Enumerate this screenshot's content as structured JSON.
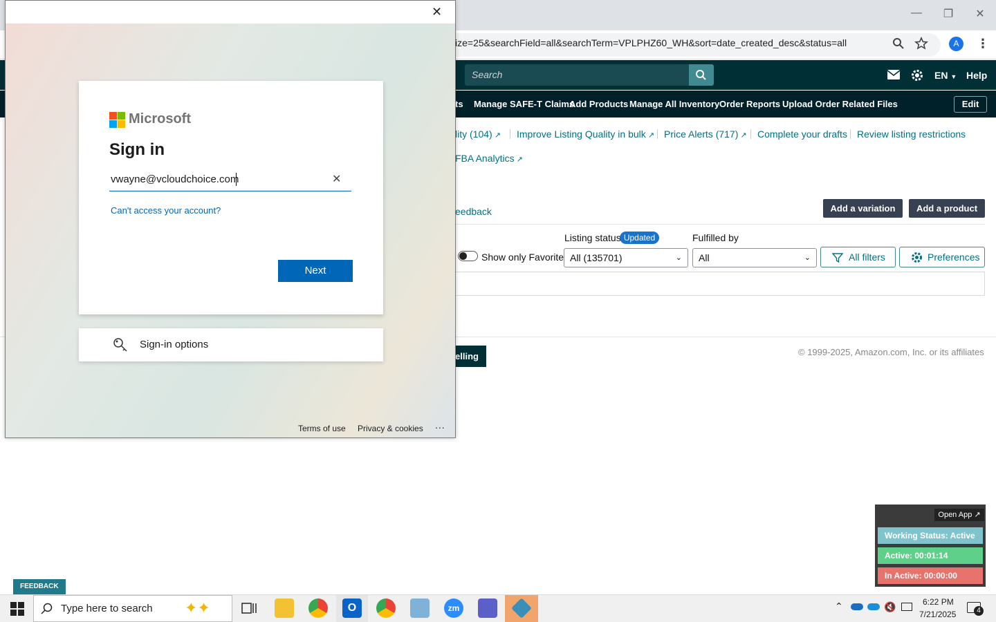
{
  "browser": {
    "url": "ize=25&searchField=all&searchTerm=VPLPHZ60_WH&sort=date_created_desc&status=all",
    "profile_initial": "A"
  },
  "amazon": {
    "search_placeholder": "Search",
    "language": "EN",
    "help": "Help",
    "subnav": [
      "ts",
      "Manage SAFE-T Claims",
      "Add Products",
      "Manage All Inventory",
      "Order Reports",
      "Upload Order Related Files"
    ],
    "edit": "Edit",
    "links_row1": [
      "lity (104)",
      "Improve Listing Quality in bulk",
      "Price Alerts (717)",
      "Complete your drafts",
      "Review listing restrictions"
    ],
    "fba_analytics": "FBA Analytics",
    "feedback_link": "eedback",
    "add_variation": "Add a variation",
    "add_product": "Add a product",
    "listing_status_label": "Listing status",
    "updated_badge": "Updated",
    "fulfilled_by_label": "Fulfilled by",
    "show_favorites": "Show only Favorites",
    "listing_status_value": "All (135701)",
    "fulfilled_by_value": "All",
    "all_filters": "All filters",
    "preferences": "Preferences",
    "selling_btn": "elling",
    "copyright": "© 1999-2025, Amazon.com, Inc. or its affiliates"
  },
  "ms_signin": {
    "brand": "Microsoft",
    "heading": "Sign in",
    "email_value": "vwayne@vcloudchoice.com",
    "cant_access": "Can't access your account?",
    "next": "Next",
    "signin_options": "Sign-in options",
    "terms": "Terms of use",
    "privacy": "Privacy & cookies",
    "more": "..."
  },
  "tracker": {
    "open_app": "Open App ↗",
    "status": "Working Status: Active",
    "active": "Active: 00:01:14",
    "inactive": "In Active: 00:00:00",
    "colors": {
      "status": "#7fc4cc",
      "active": "#5fd08a",
      "inactive": "#e8736c"
    }
  },
  "feedback_tab": "FEEDBACK ✕",
  "taskbar": {
    "search_placeholder": "Type here to search",
    "time": "6:22 PM",
    "date": "7/21/2025",
    "notification_count": "4"
  }
}
